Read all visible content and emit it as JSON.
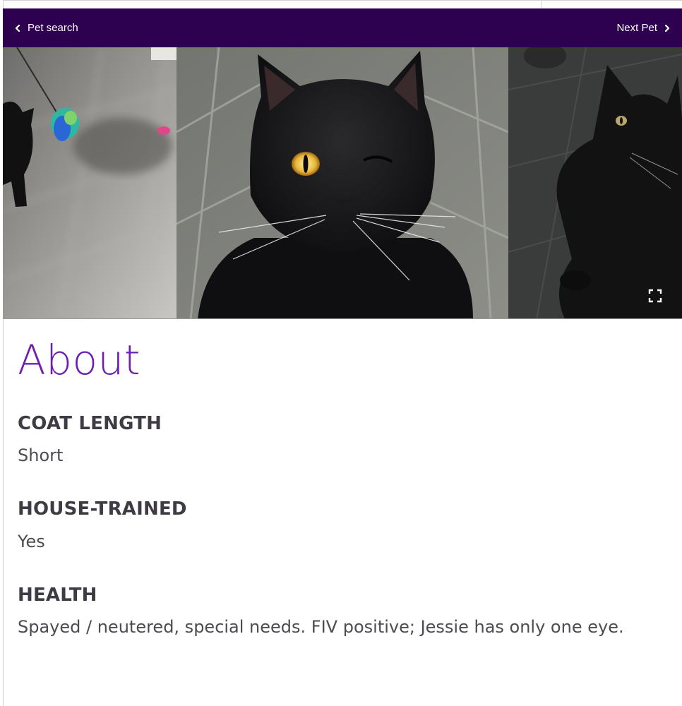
{
  "nav": {
    "back_label": "Pet search",
    "next_label": "Next Pet"
  },
  "colors": {
    "nav_bg": "#2e0050",
    "accent_purple": "#6e1fb0",
    "text_dark": "#3e3b45"
  },
  "about": {
    "title": "About",
    "facts": [
      {
        "label": "COAT LENGTH",
        "value": "Short"
      },
      {
        "label": "HOUSE-TRAINED",
        "value": "Yes"
      },
      {
        "label": "HEALTH",
        "value": "Spayed / neutered, special needs. FIV positive; Jessie has only one eye."
      }
    ]
  },
  "icons": {
    "back": "chevron-left-icon",
    "next": "chevron-right-icon",
    "fullscreen": "fullscreen-icon"
  }
}
